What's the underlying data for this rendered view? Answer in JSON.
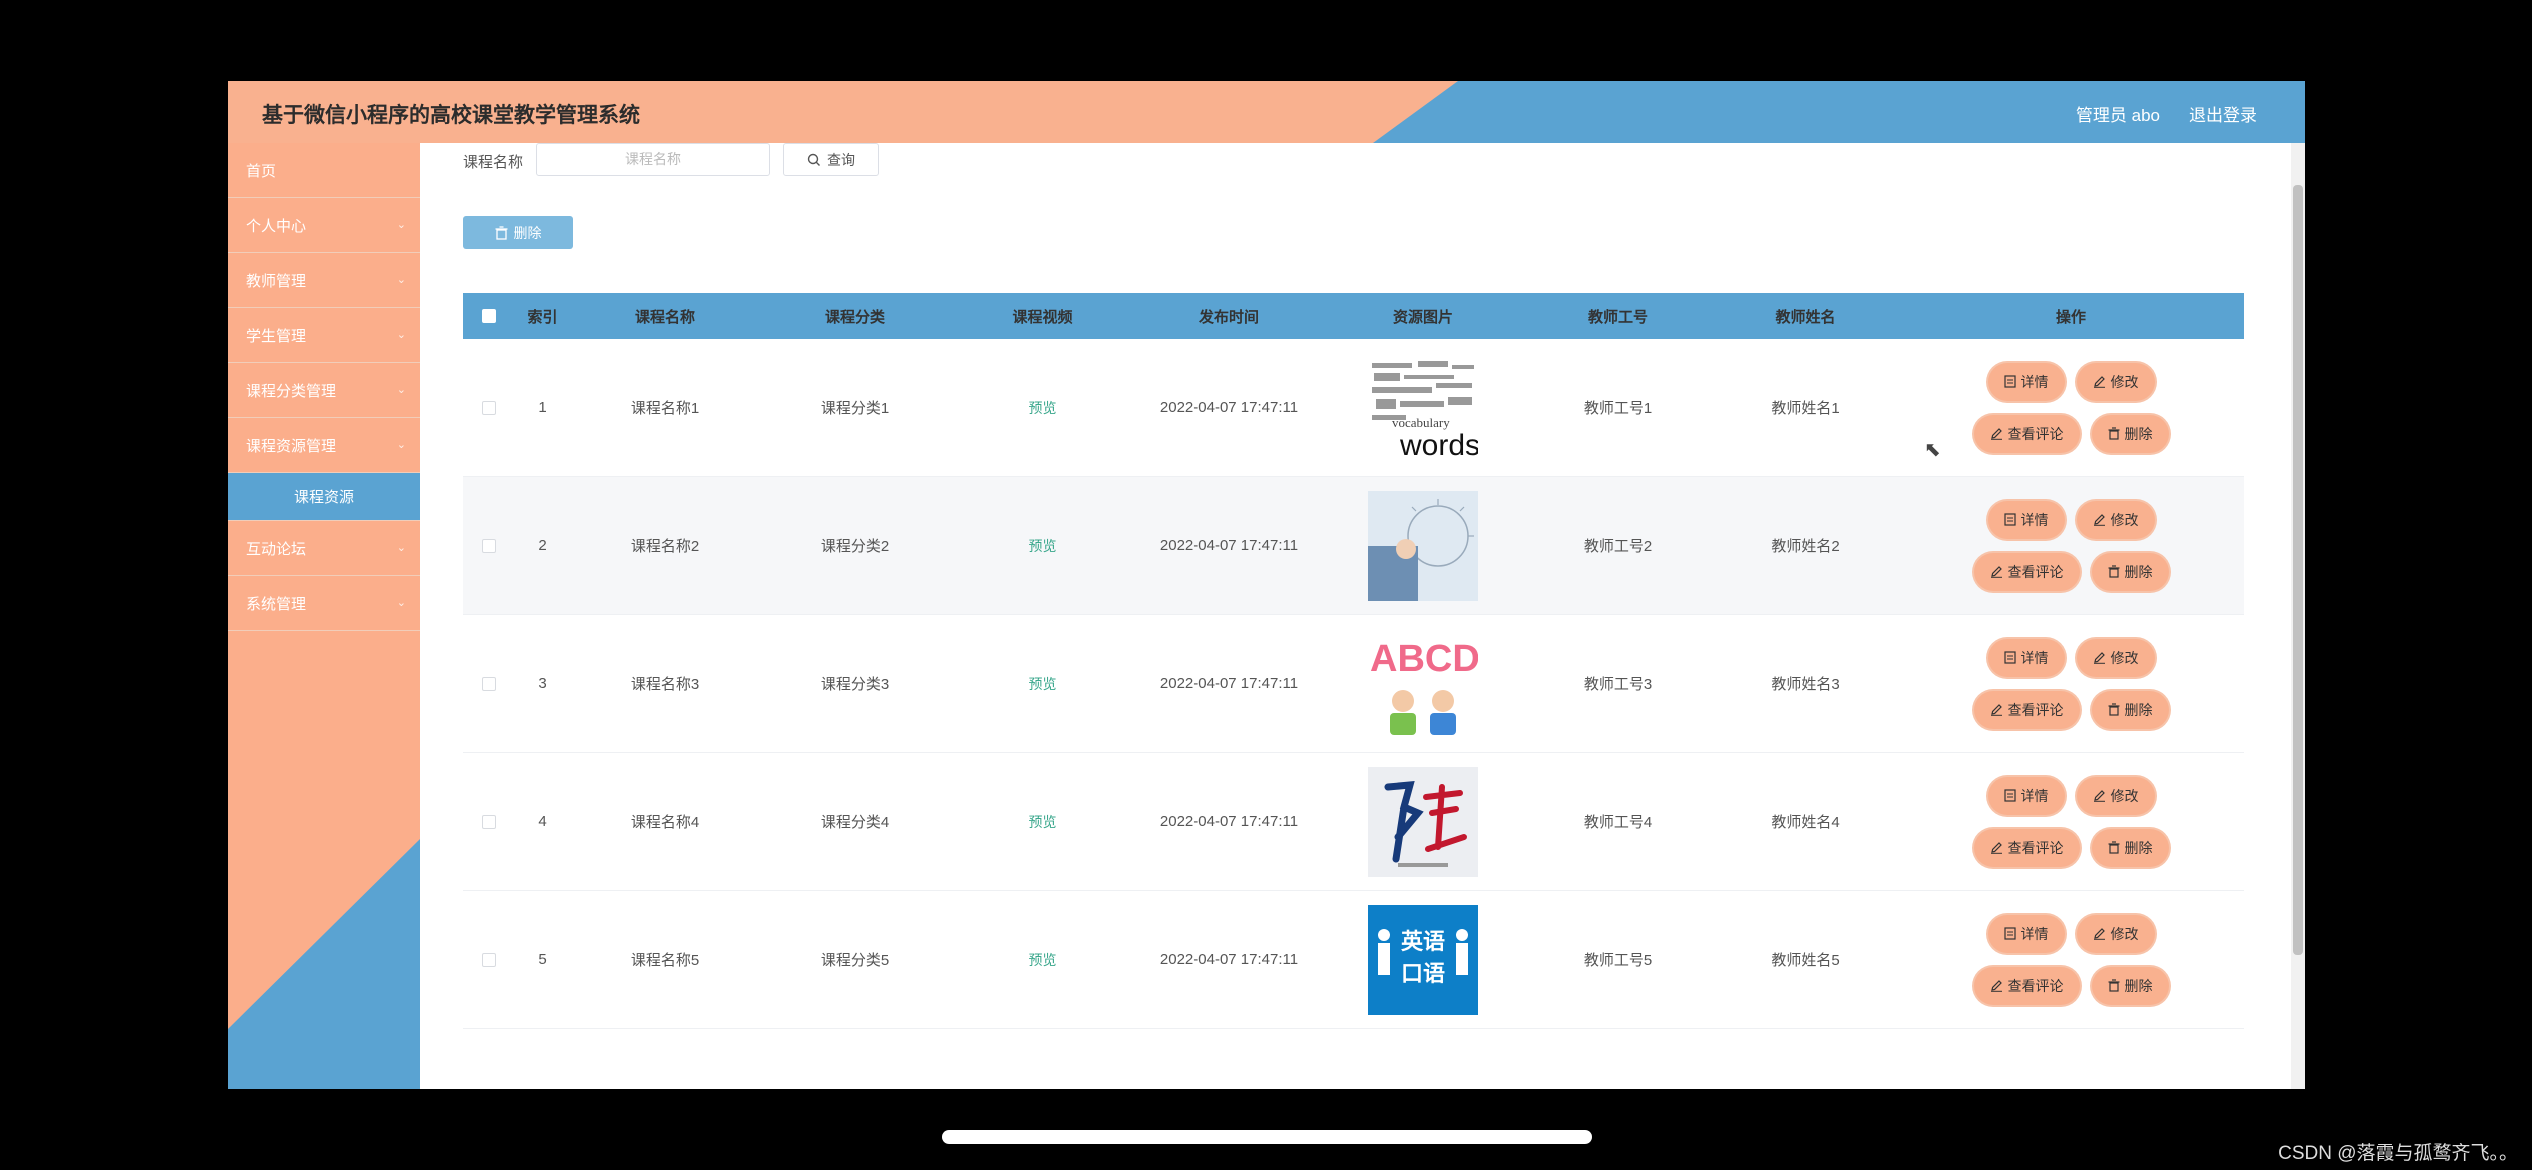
{
  "header": {
    "title": "基于微信小程序的高校课堂教学管理系统",
    "user": "管理员 abo",
    "logout": "退出登录"
  },
  "sidebar": {
    "items": [
      {
        "label": "首页",
        "chevron": false
      },
      {
        "label": "个人中心",
        "chevron": true
      },
      {
        "label": "教师管理",
        "chevron": true
      },
      {
        "label": "学生管理",
        "chevron": true
      },
      {
        "label": "课程分类管理",
        "chevron": true
      },
      {
        "label": "课程资源管理",
        "chevron": true
      }
    ],
    "sub_item": "课程资源",
    "items_after": [
      {
        "label": "互动论坛",
        "chevron": true
      },
      {
        "label": "系统管理",
        "chevron": true
      }
    ]
  },
  "search": {
    "label": "课程名称",
    "placeholder": "课程名称",
    "button": "查询"
  },
  "toolbar": {
    "delete": "删除"
  },
  "table": {
    "headers": [
      "索引",
      "课程名称",
      "课程分类",
      "课程视频",
      "发布时间",
      "资源图片",
      "教师工号",
      "教师姓名",
      "操作"
    ],
    "rows": [
      {
        "index": "1",
        "name": "课程名称1",
        "category": "课程分类1",
        "video": "预览",
        "time": "2022-04-07 17:47:11",
        "teacher_no": "教师工号1",
        "teacher_name": "教师姓名1",
        "image_icon": "vocabulary-words-image"
      },
      {
        "index": "2",
        "name": "课程名称2",
        "category": "课程分类2",
        "video": "预览",
        "time": "2022-04-07 17:47:11",
        "teacher_no": "教师工号2",
        "teacher_name": "教师姓名2",
        "image_icon": "business-training-image"
      },
      {
        "index": "3",
        "name": "课程名称3",
        "category": "课程分类3",
        "video": "预览",
        "time": "2022-04-07 17:47:11",
        "teacher_no": "教师工号3",
        "teacher_name": "教师姓名3",
        "image_icon": "abcd-kids-image"
      },
      {
        "index": "4",
        "name": "课程名称4",
        "category": "课程分类4",
        "video": "预览",
        "time": "2022-04-07 17:47:11",
        "teacher_no": "教师工号4",
        "teacher_name": "教师姓名4",
        "image_icon": "calligraphy-image"
      },
      {
        "index": "5",
        "name": "课程名称5",
        "category": "课程分类5",
        "video": "预览",
        "time": "2022-04-07 17:47:11",
        "teacher_no": "教师工号5",
        "teacher_name": "教师姓名5",
        "image_icon": "english-oral-image"
      }
    ],
    "ops": {
      "detail": "详情",
      "edit": "修改",
      "comments": "查看评论",
      "delete": "删除"
    }
  },
  "image_text": {
    "row1": "words",
    "row3": "ABCD",
    "row5_top": "英语",
    "row5_bottom": "口语"
  },
  "watermark": "CSDN @落霞与孤鹜齐飞。。",
  "colors": {
    "salmon": "#f9b18f",
    "blue": "#5aa3d2",
    "preview": "#3aa78c"
  }
}
